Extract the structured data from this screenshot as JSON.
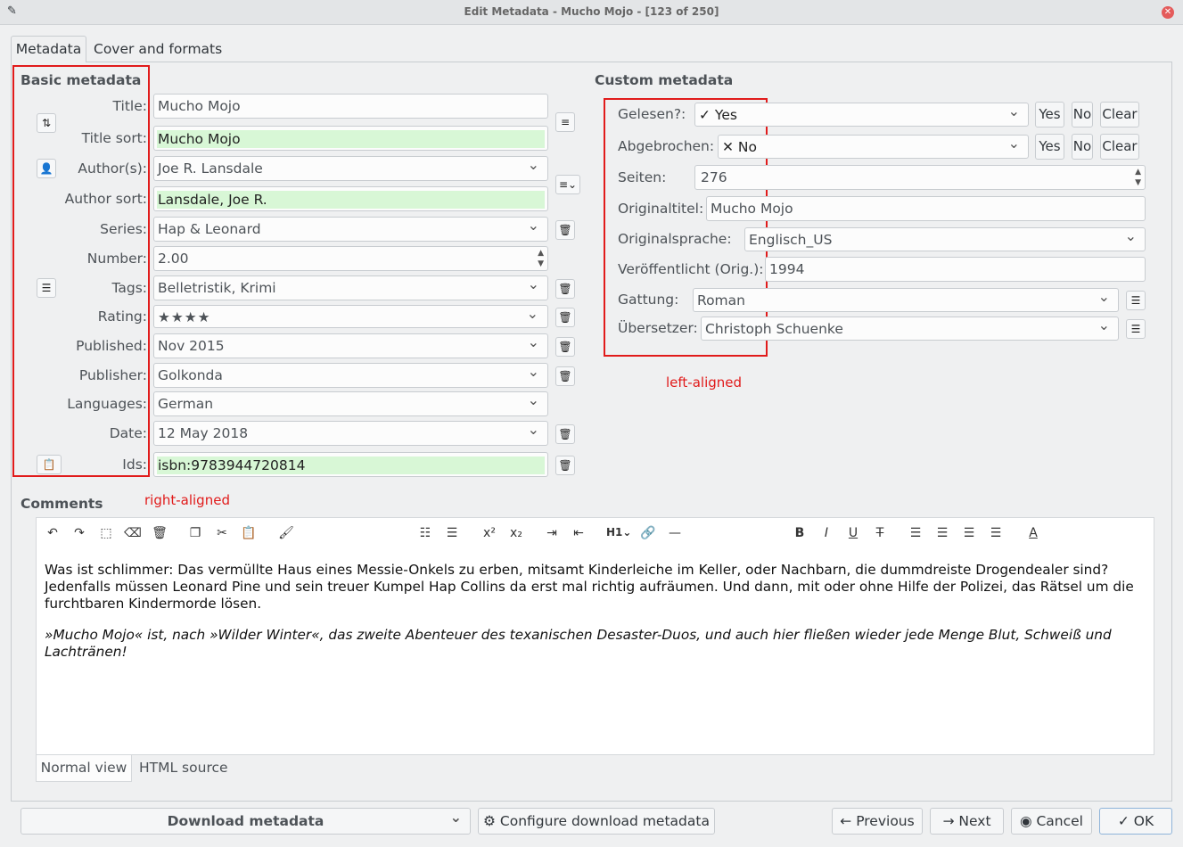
{
  "window": {
    "title": "Edit Metadata - Mucho Mojo -  [123 of 250]"
  },
  "tabs": [
    "Metadata",
    "Cover and formats"
  ],
  "basic": {
    "header": "Basic metadata",
    "title_label": "Title:",
    "title": "Mucho Mojo",
    "title_sort_label": "Title sort:",
    "title_sort": "Mucho Mojo",
    "authors_label": "Author(s):",
    "authors": "Joe R. Lansdale",
    "author_sort_label": "Author sort:",
    "author_sort": "Lansdale, Joe R.",
    "series_label": "Series:",
    "series": "Hap & Leonard",
    "number_label": "Number:",
    "number": "2.00",
    "tags_label": "Tags:",
    "tags": "Belletristik, Krimi",
    "rating_label": "Rating:",
    "rating": "★★★★",
    "published_label": "Published:",
    "published": "Nov 2015",
    "publisher_label": "Publisher:",
    "publisher": "Golkonda",
    "languages_label": "Languages:",
    "languages": "German",
    "date_label": "Date:",
    "date": "12 May 2018",
    "ids_label": "Ids:",
    "ids": "isbn:9783944720814"
  },
  "custom": {
    "header": "Custom metadata",
    "gelesen_label": "Gelesen?:",
    "gelesen": "✓ Yes",
    "abgebrochen_label": "Abgebrochen:",
    "abgebrochen": "✕ No",
    "seiten_label": "Seiten:",
    "seiten": "276",
    "originaltitel_label": "Originaltitel:",
    "originaltitel": "Mucho Mojo",
    "originalsprache_label": "Originalsprache:",
    "originalsprache": "Englisch_US",
    "veroeffentlicht_label": "Veröffentlicht (Orig.):",
    "veroeffentlicht": "1994",
    "gattung_label": "Gattung:",
    "gattung": "Roman",
    "uebersetzer_label": "Übersetzer:",
    "uebersetzer": "Christoph Schuenke",
    "yes": "Yes",
    "no": "No",
    "clear": "Clear"
  },
  "annotations": {
    "left": "left-aligned",
    "right": "right-aligned"
  },
  "comments": {
    "header": "Comments",
    "para1": "Was ist schlimmer: Das vermüllte Haus eines Messie-Onkels zu erben, mitsamt Kinderleiche im Keller, oder Nachbarn, die dummdreiste Drogendealer sind? Jedenfalls müssen Leonard Pine und sein treuer Kumpel Hap Collins da erst mal richtig aufräumen. Und dann, mit oder ohne Hilfe der Polizei, das Rätsel um die furchtbaren Kindermorde lösen.",
    "para2": "»Mucho Mojo« ist, nach »Wilder Winter«, das zweite Abenteuer des texanischen Desaster-Duos, und auch hier fließen wieder jede Menge Blut, Schweiß und Lachtränen!",
    "tab_normal": "Normal view",
    "tab_html": "HTML source"
  },
  "toolbar": {
    "heading": "H1"
  },
  "footer": {
    "download": "Download metadata",
    "configure": "Configure download metadata",
    "previous": "Previous",
    "next": "Next",
    "cancel": "Cancel",
    "ok": "OK"
  }
}
